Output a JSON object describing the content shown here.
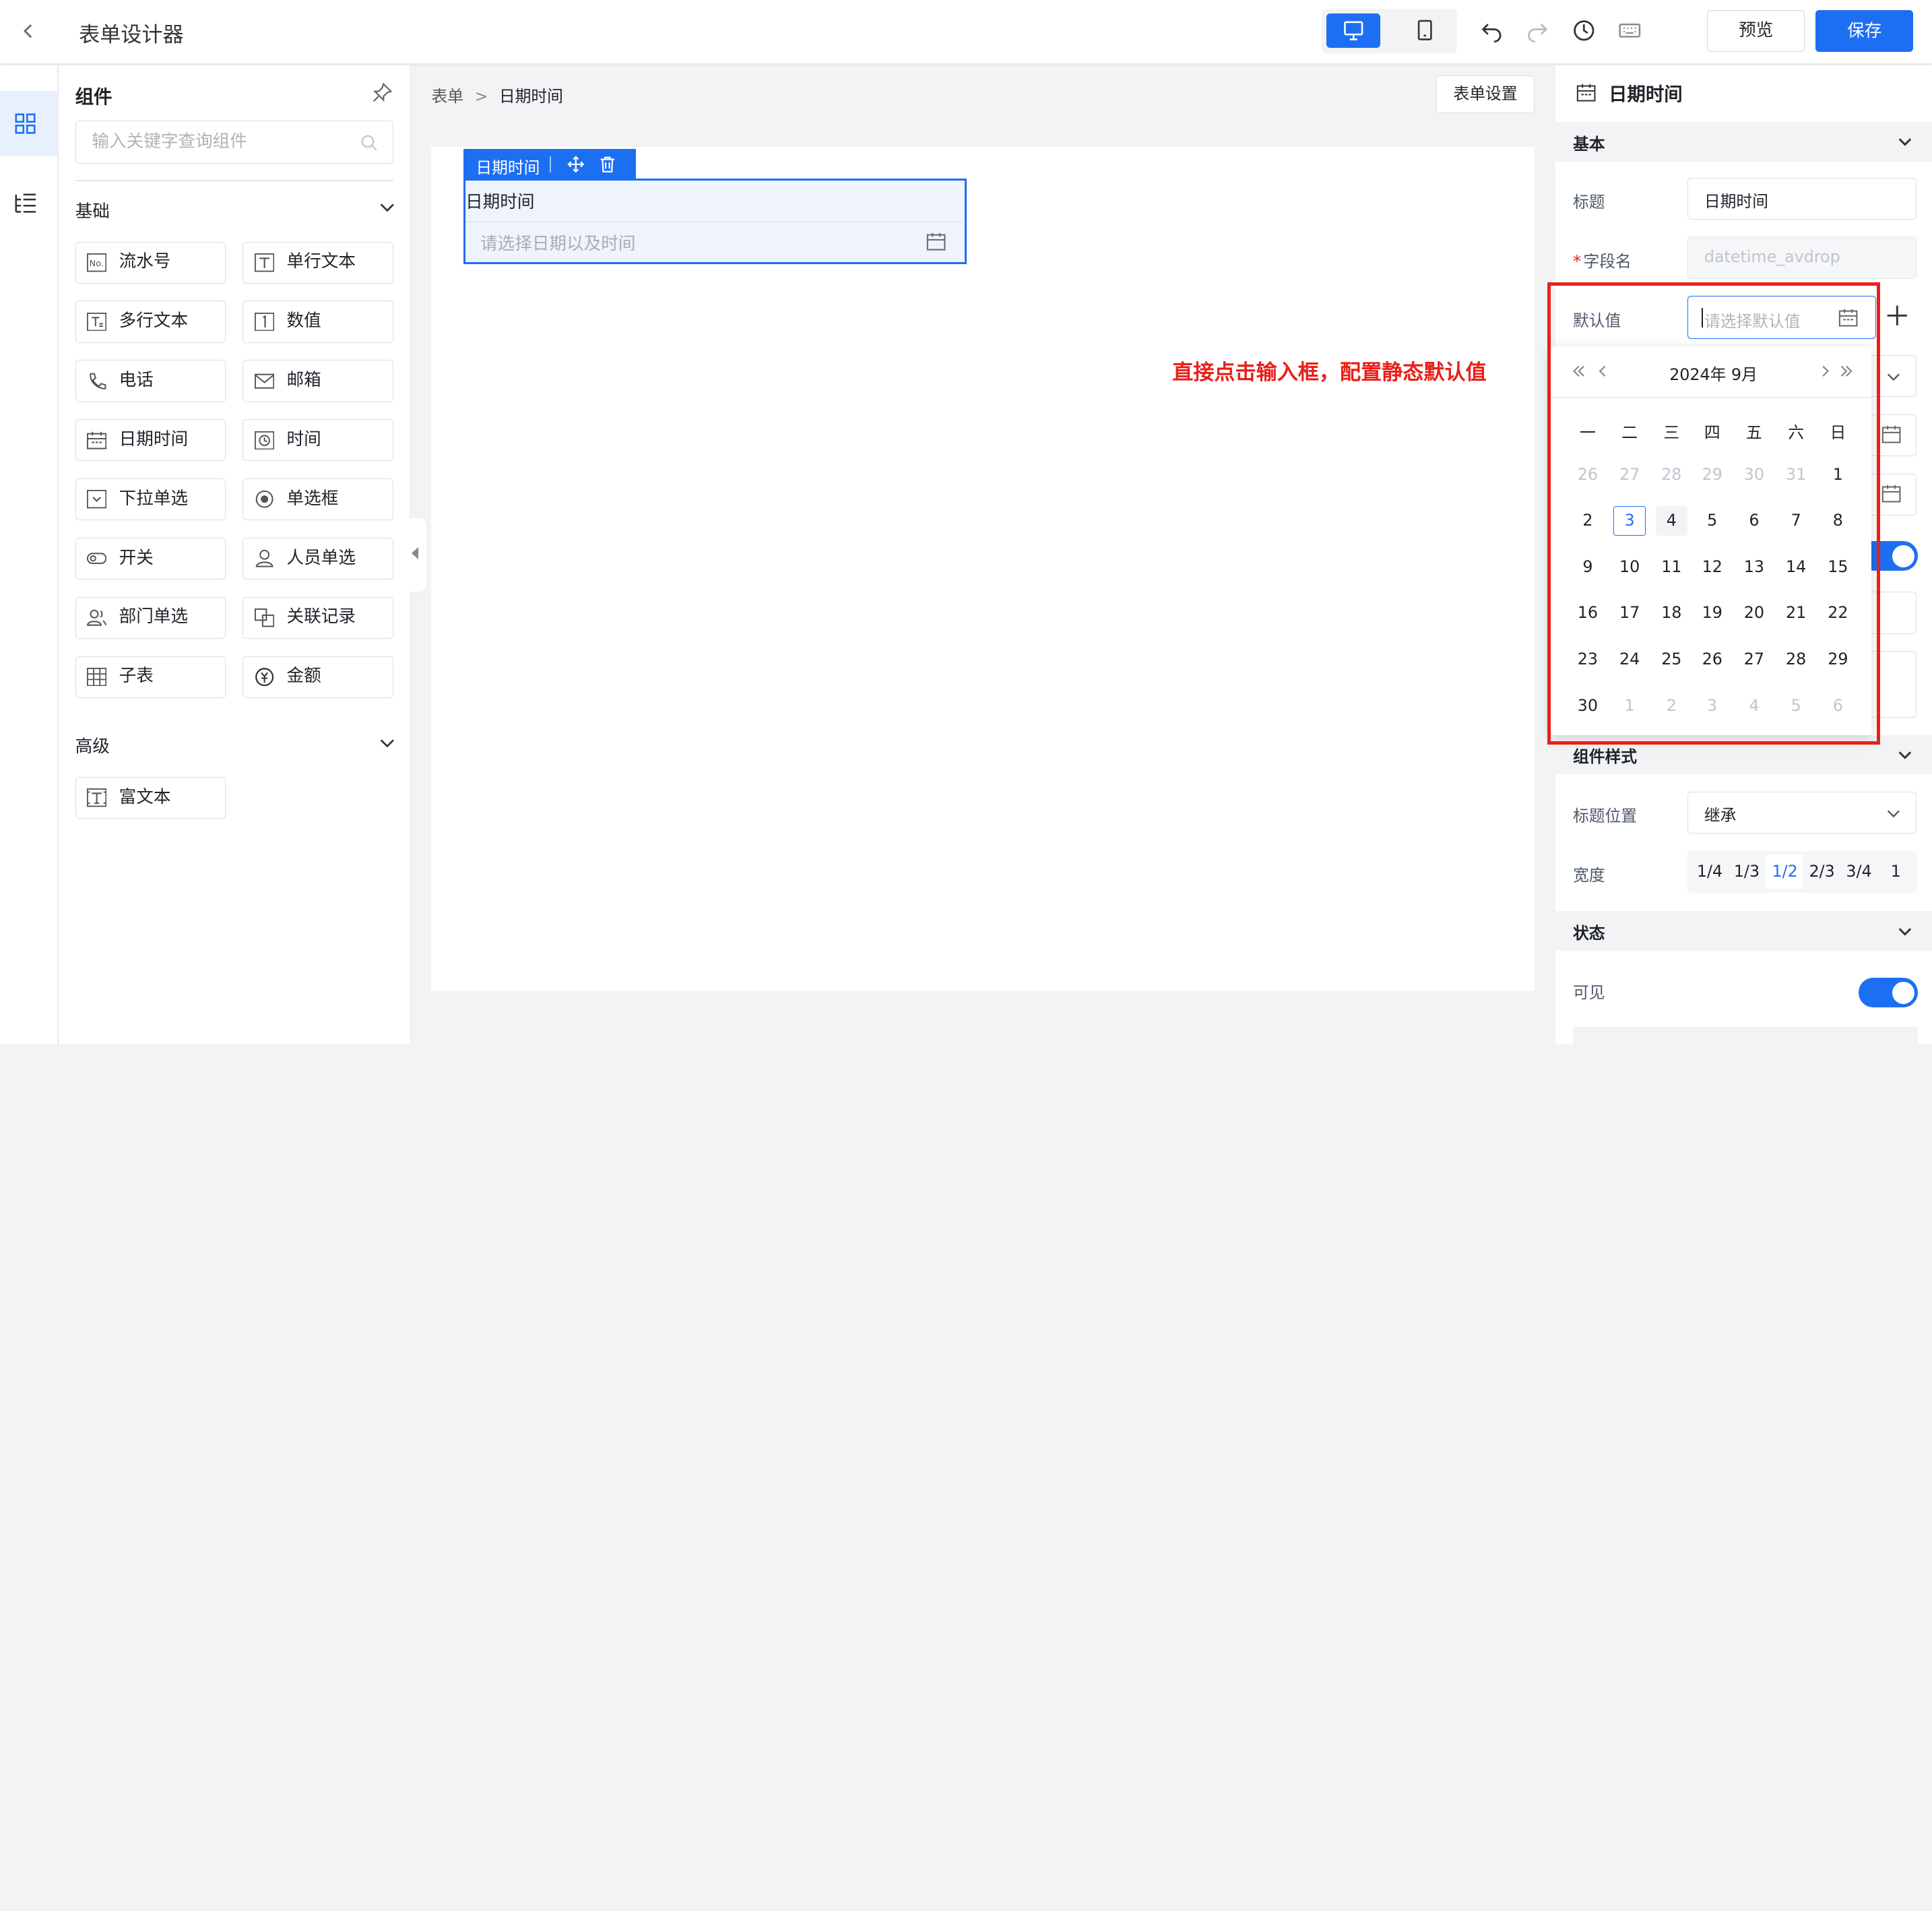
{
  "header": {
    "title": "表单设计器",
    "preview_label": "预览",
    "save_label": "保存"
  },
  "components_panel": {
    "title": "组件",
    "search_placeholder": "输入关键字查询组件",
    "groups": [
      {
        "label": "基础",
        "items": [
          "流水号",
          "单行文本",
          "多行文本",
          "数值",
          "电话",
          "邮箱",
          "日期时间",
          "时间",
          "下拉单选",
          "单选框",
          "开关",
          "人员单选",
          "部门单选",
          "关联记录",
          "子表",
          "金额"
        ]
      },
      {
        "label": "高级",
        "items": [
          "富文本"
        ]
      }
    ]
  },
  "canvas": {
    "breadcrumb": [
      "表单",
      "日期时间"
    ],
    "breadcrumb_sep": ">",
    "form_settings_label": "表单设置",
    "field": {
      "toolbar_label": "日期时间",
      "label": "日期时间",
      "placeholder": "请选择日期以及时间"
    },
    "annotation": "直接点击输入框，配置静态默认值"
  },
  "properties_panel": {
    "title": "日期时间",
    "sections": {
      "basic": "基本",
      "style": "组件样式",
      "state": "状态"
    },
    "fields": {
      "title_label": "标题",
      "title_value": "日期时间",
      "field_name_label": "字段名",
      "field_name_value": "datetime_avdrop",
      "default_label": "默认值",
      "default_placeholder": "请选择默认值",
      "title_position_label": "标题位置",
      "title_position_value": "继承",
      "width_label": "宽度",
      "width_options": [
        "1/4",
        "1/3",
        "1/2",
        "2/3",
        "3/4",
        "1"
      ],
      "width_selected": "1/2",
      "visible_label": "可见",
      "visible_on": true
    }
  },
  "date_picker": {
    "title": "2024年 9月",
    "weekdays": [
      "一",
      "二",
      "三",
      "四",
      "五",
      "六",
      "日"
    ],
    "weeks": [
      [
        "26",
        "27",
        "28",
        "29",
        "30",
        "31",
        "1"
      ],
      [
        "2",
        "3",
        "4",
        "5",
        "6",
        "7",
        "8"
      ],
      [
        "9",
        "10",
        "11",
        "12",
        "13",
        "14",
        "15"
      ],
      [
        "16",
        "17",
        "18",
        "19",
        "20",
        "21",
        "22"
      ],
      [
        "23",
        "24",
        "25",
        "26",
        "27",
        "28",
        "29"
      ],
      [
        "30",
        "1",
        "2",
        "3",
        "4",
        "5",
        "6"
      ]
    ],
    "today": "3",
    "hovered": "4"
  },
  "colors": {
    "accent": "#1d6ff2",
    "annotation": "#e8201a"
  }
}
